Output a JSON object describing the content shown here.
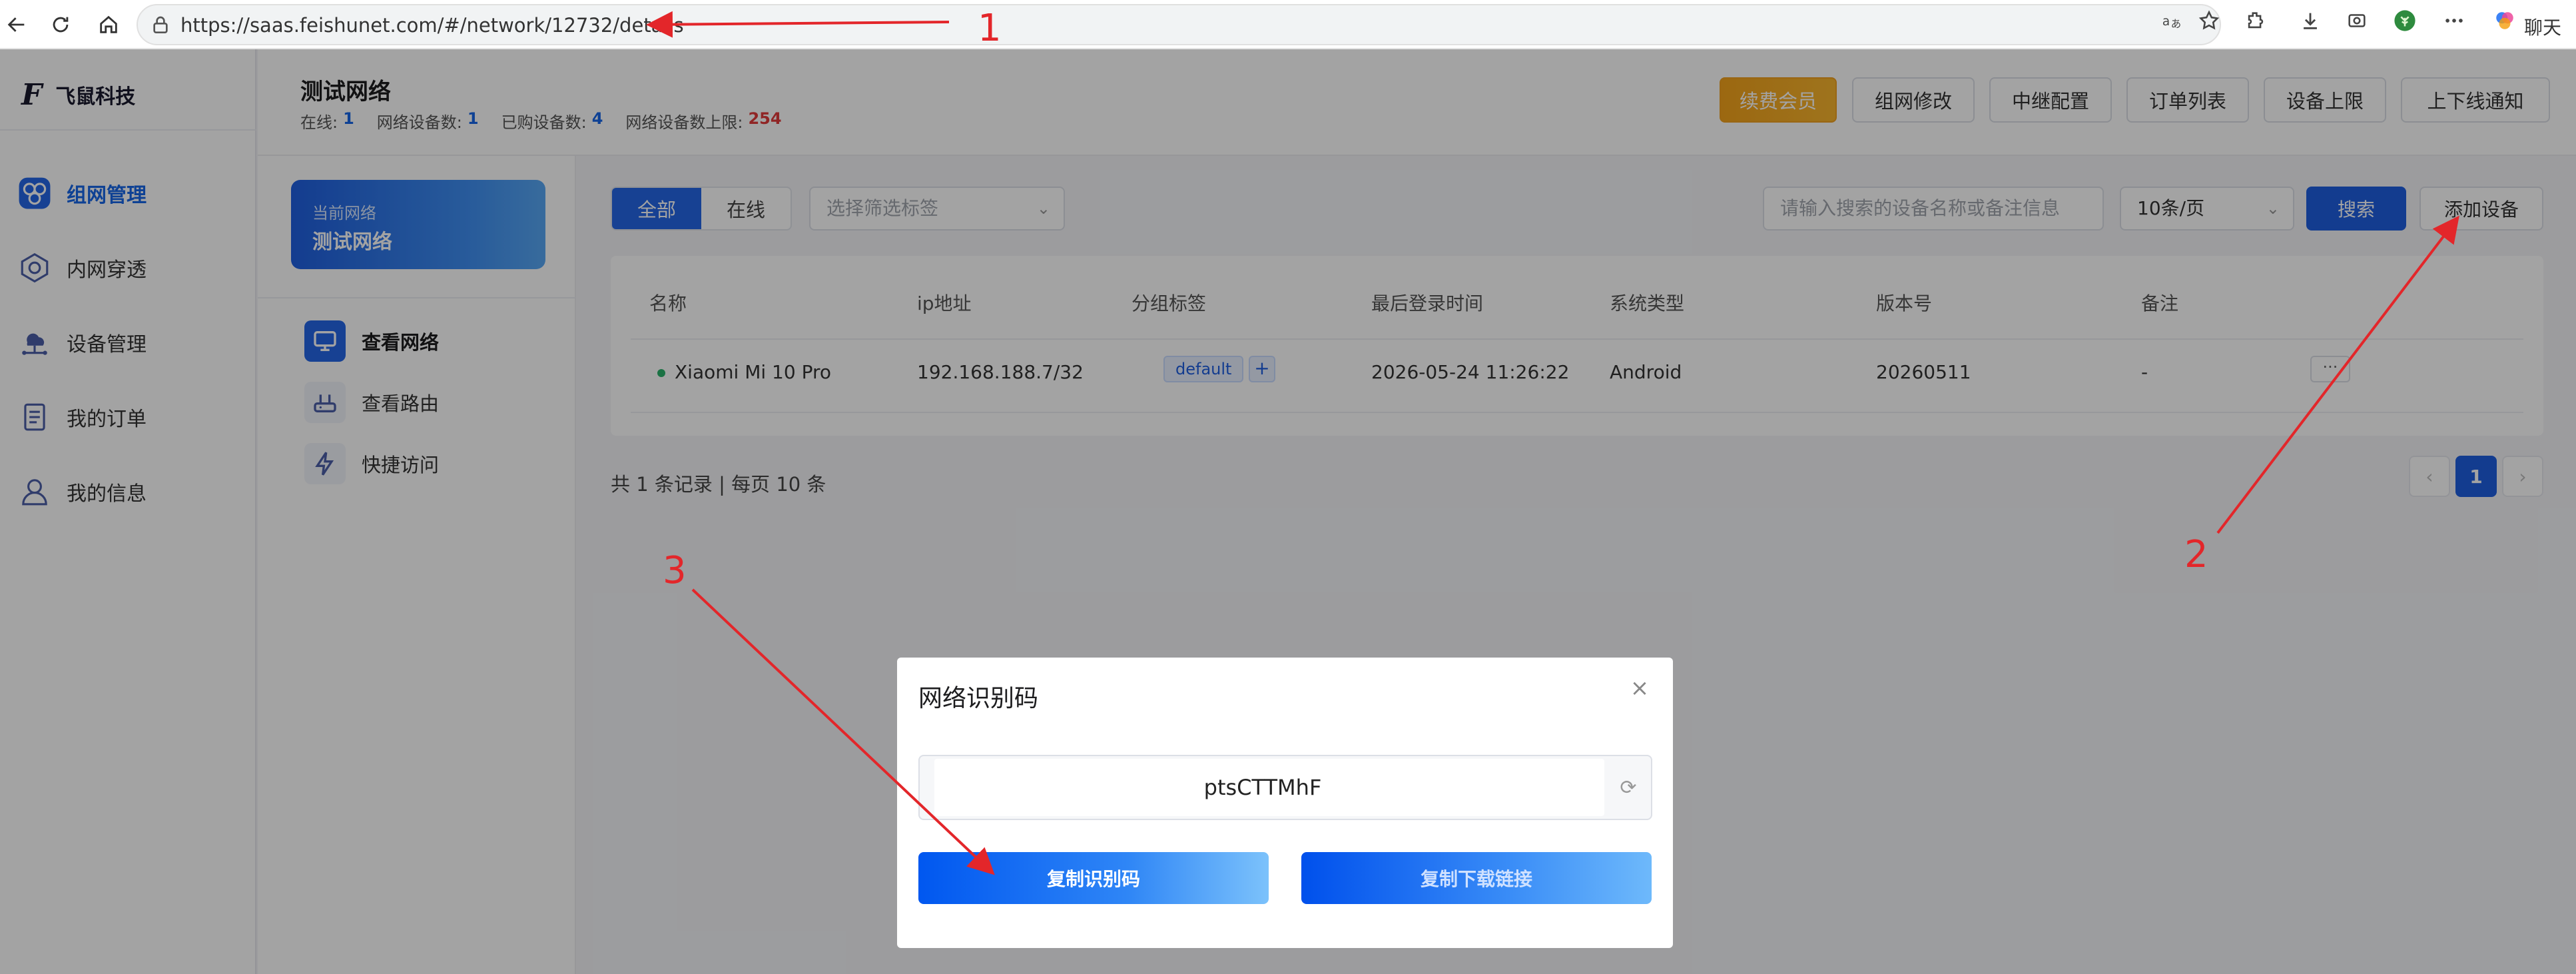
{
  "browser": {
    "url": "https://saas.feishunet.com/#/network/12732/details",
    "chat_label": "聊天"
  },
  "annotations": {
    "n1": "1",
    "n2": "2",
    "n3": "3"
  },
  "brand": {
    "mark": "F",
    "name": "飞鼠科技"
  },
  "sidebar": {
    "items": [
      {
        "label": "组网管理",
        "icon": "network-hub-icon",
        "active": true
      },
      {
        "label": "内网穿透",
        "icon": "tunnel-icon"
      },
      {
        "label": "设备管理",
        "icon": "device-cloud-icon"
      },
      {
        "label": "我的订单",
        "icon": "order-list-icon"
      },
      {
        "label": "我的信息",
        "icon": "user-icon"
      }
    ]
  },
  "header": {
    "network_name": "测试网络",
    "stats": [
      {
        "label": "在线:",
        "value": "1"
      },
      {
        "label": "网络设备数:",
        "value": "1"
      },
      {
        "label": "已购设备数:",
        "value": "4"
      },
      {
        "label": "网络设备数上限:",
        "value": "254"
      }
    ],
    "buttons": [
      "续费会员",
      "组网修改",
      "中继配置",
      "订单列表",
      "设备上限",
      "上下线通知"
    ]
  },
  "subnav": {
    "current_label": "当前网络",
    "current_name": "测试网络",
    "items": [
      {
        "label": "查看网络",
        "active": true
      },
      {
        "label": "查看路由"
      },
      {
        "label": "快捷访问"
      }
    ]
  },
  "toolbar": {
    "seg_all": "全部",
    "seg_online": "在线",
    "tag_placeholder": "选择筛选标签",
    "search_placeholder": "请输入搜索的设备名称或备注信息",
    "page_size": "10条/页",
    "search_btn": "搜索",
    "add_btn": "添加设备"
  },
  "table": {
    "headers": [
      "名称",
      "ip地址",
      "分组标签",
      "最后登录时间",
      "系统类型",
      "版本号",
      "备注"
    ],
    "rows": [
      {
        "name": "Xiaomi Mi 10 Pro",
        "ip": "192.168.188.7/32",
        "tag": "default",
        "tag_add": "+",
        "last_login": "2026-05-24 11:26:22",
        "os": "Android",
        "version": "20260511",
        "note": "-",
        "more": "···"
      }
    ]
  },
  "pagination": {
    "summary": "共 1 条记录 | 每页 10 条",
    "prev": "‹",
    "current": "1",
    "next": "›"
  },
  "modal": {
    "title": "网络识别码",
    "code": "ptsCTTMhF",
    "copy_code": "复制识别码",
    "copy_link": "复制下载链接",
    "close": "×",
    "refresh": "⟳"
  }
}
